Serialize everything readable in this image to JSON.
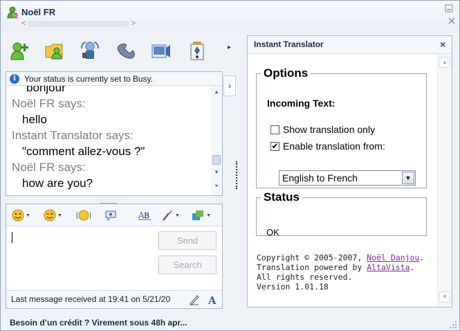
{
  "window": {
    "title": "Noël FR",
    "subline_left": "<",
    "subline_right": ">",
    "controls": {
      "minimize_icon": "minimize-icon",
      "close_icon": "close-icon"
    }
  },
  "toolbar": {
    "items": [
      "add-contact-icon",
      "share-folders-icon",
      "video-call-icon",
      "call-icon",
      "activities-icon",
      "games-icon"
    ],
    "more_label": "▸"
  },
  "conversation": {
    "status_text": "Your status is currently set to Busy.",
    "messages": [
      {
        "sender": "",
        "text": "\"bonjour\""
      },
      {
        "sender": "Noël FR says:",
        "text": "hello"
      },
      {
        "sender": "Instant Translator says:",
        "text": "\"comment allez-vous ?\""
      },
      {
        "sender": "Noël FR says:",
        "text": "how are you?"
      }
    ],
    "collapse_label": "›",
    "splitter_label": "........."
  },
  "compose": {
    "format_items": [
      "emoticon-icon",
      "wink-icon",
      "nudge-icon",
      "voice-clip-icon",
      "font-icon",
      "background-icon",
      "color-icon"
    ],
    "send_label": "Send",
    "search_label": "Search",
    "last_message": "Last message received at 19:41 on 5/21/20"
  },
  "ad": {
    "text": "Besoin d’un crédit ? Virement sous 48h apr..."
  },
  "translator": {
    "title": "Instant Translator",
    "close_label": "×",
    "options_legend": "Options",
    "incoming_label": "Incoming Text:",
    "show_only_label": "Show translation only",
    "show_only_checked": false,
    "enable_label": "Enable translation from:",
    "enable_checked": true,
    "selected_language": "English to French",
    "status_legend": "Status",
    "status_value": "OK",
    "copyright_prefix": "Copyright © 2005-2007, ",
    "author_link": "Noël Danjou",
    "period": ".",
    "powered_prefix": "Translation powered by ",
    "altavista_link": "AltaVista",
    "rights": "All rights reserved.",
    "version": "Version 1.01.18"
  },
  "colors": {
    "accent": "#2f6fc1",
    "link": "#7a2e8e",
    "sender_gray": "#7d7d7d"
  }
}
